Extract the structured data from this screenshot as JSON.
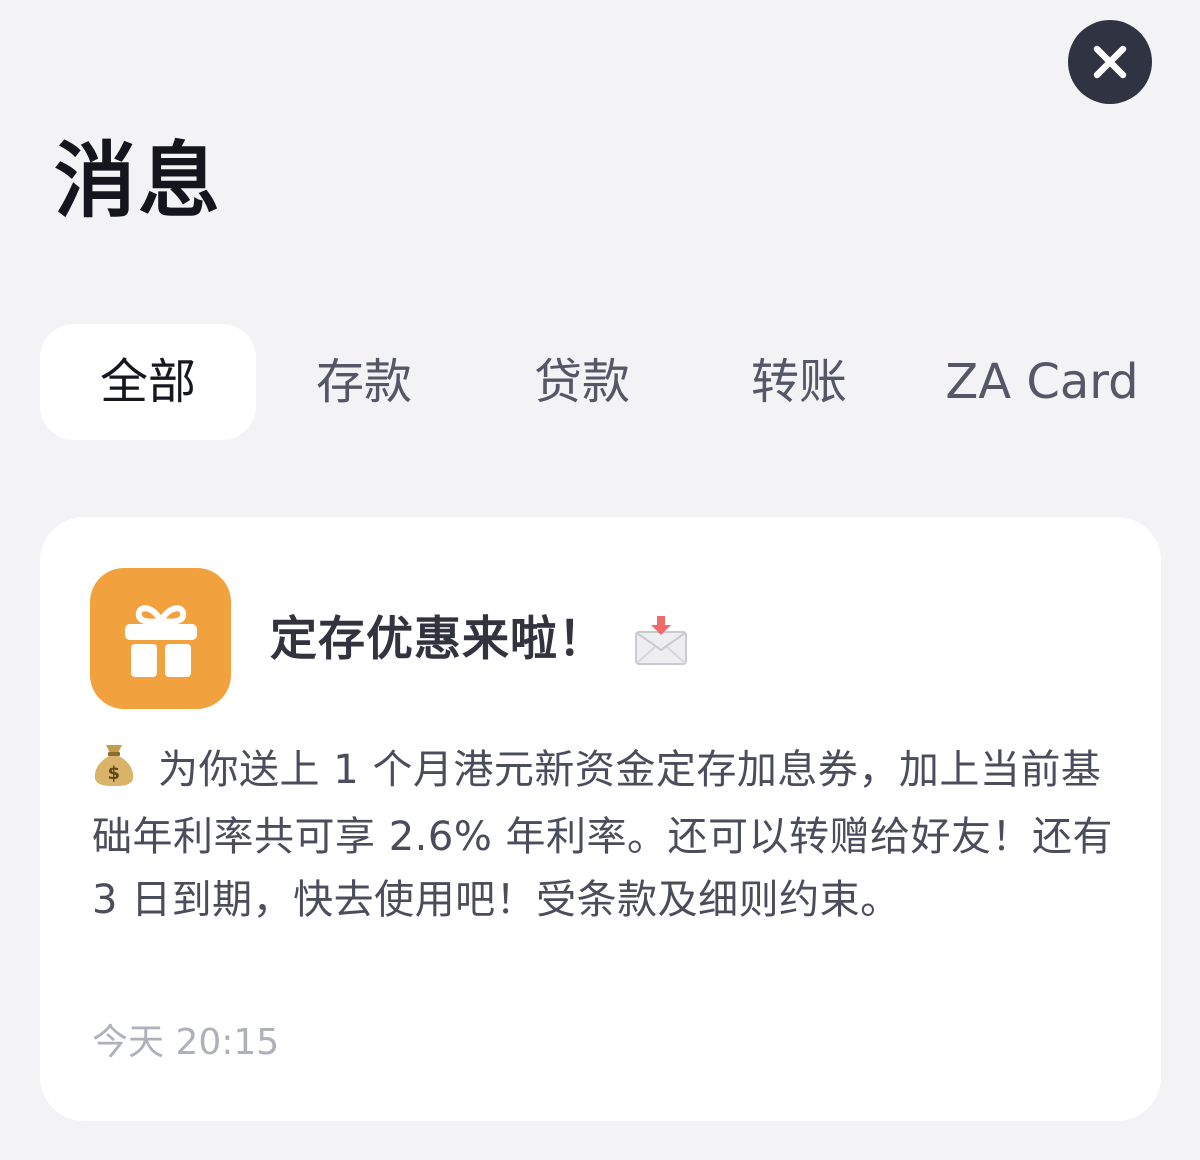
{
  "header": {
    "title": "消息",
    "close_icon": "close-icon"
  },
  "tabs": [
    {
      "label": "全部",
      "active": true
    },
    {
      "label": "存款",
      "active": false
    },
    {
      "label": "贷款",
      "active": false
    },
    {
      "label": "转账",
      "active": false
    },
    {
      "label": "ZA Card",
      "active": false
    }
  ],
  "message": {
    "icon": "gift-icon",
    "icon_color": "#f1a13e",
    "title": "定存优惠来啦！",
    "title_emoji": "envelope-icon",
    "body_emoji": "money-bag-icon",
    "body": "为你送上 1 个月港元新资金定存加息券，加上当前基础年利率共可享 2.6% 年利率。还可以转赠给好友！还有 3 日到期，快去使用吧！受条款及细则约束。",
    "time": "今天 20:15"
  },
  "colors": {
    "background": "#f3f3f6",
    "close_button": "#303341",
    "card": "#ffffff"
  }
}
